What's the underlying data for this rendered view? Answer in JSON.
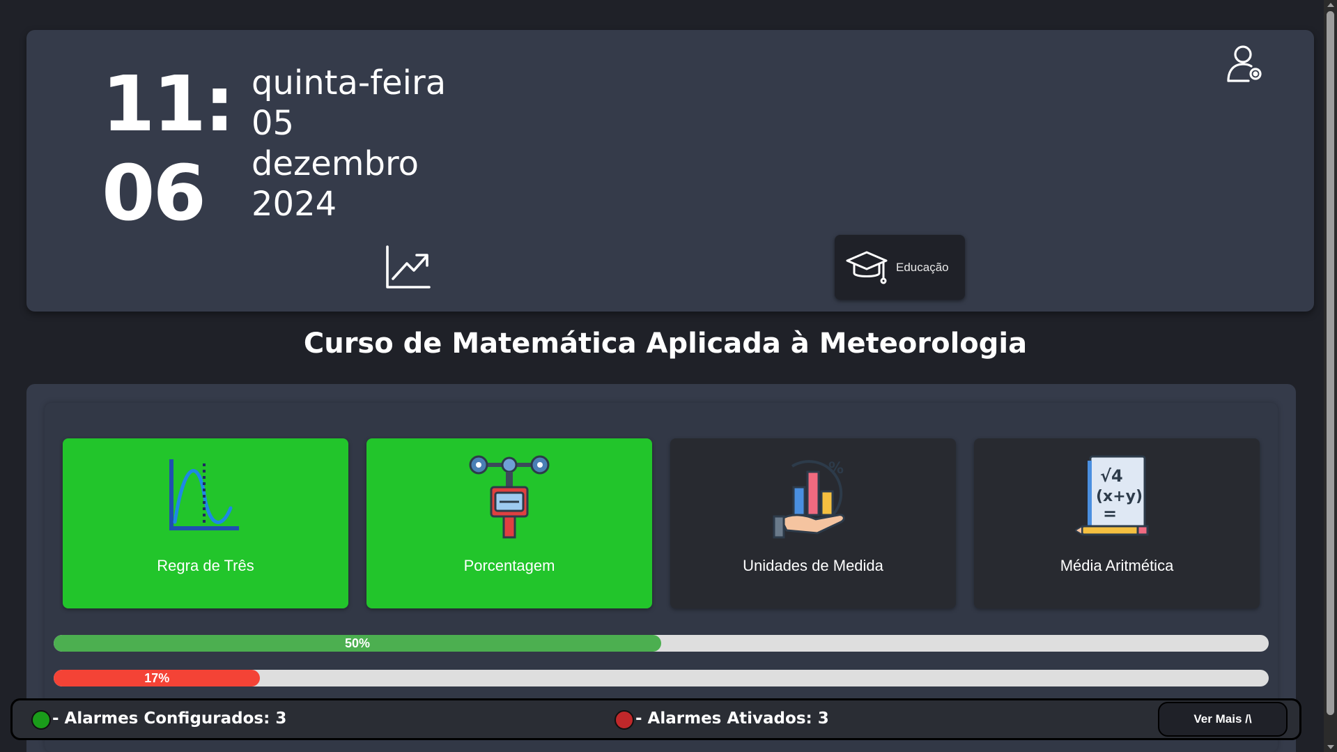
{
  "header": {
    "clock": {
      "hours": "11:",
      "minutes": "06"
    },
    "date": {
      "weekday": "quinta-feira",
      "day": "05",
      "month": "dezembro",
      "year": "2024"
    },
    "user_icon": "user-settings-icon",
    "chart_icon": "trending-up-chart-icon",
    "education_button": {
      "label": "Educação",
      "icon": "graduation-cap-icon"
    }
  },
  "course": {
    "title": "Curso de Matemática Aplicada à Meteorologia"
  },
  "cards": [
    {
      "label": "Regra de Três",
      "icon": "wave-graph-icon",
      "status": "completed",
      "color": "#22c52b"
    },
    {
      "label": "Porcentagem",
      "icon": "anemometer-icon",
      "status": "completed",
      "color": "#22c52b"
    },
    {
      "label": "Unidades de Medida",
      "icon": "hand-bar-chart-percent-icon",
      "status": "pending",
      "color": "#282a30"
    },
    {
      "label": "Média Aritmética",
      "icon": "math-formula-paper-icon",
      "status": "pending",
      "color": "#282a30"
    }
  ],
  "progress": [
    {
      "label": "50%",
      "value": 0.5,
      "color": "#4caf50"
    },
    {
      "label": "17%",
      "value": 0.17,
      "color": "#f44336"
    }
  ],
  "footer": {
    "configured": {
      "text": "- Alarmes Configurados: 3",
      "dot_color": "#1a9c1a"
    },
    "active": {
      "text": "- Alarmes Ativados: 3",
      "dot_color": "#c0282a"
    },
    "more_button": "Ver Mais /\\"
  }
}
